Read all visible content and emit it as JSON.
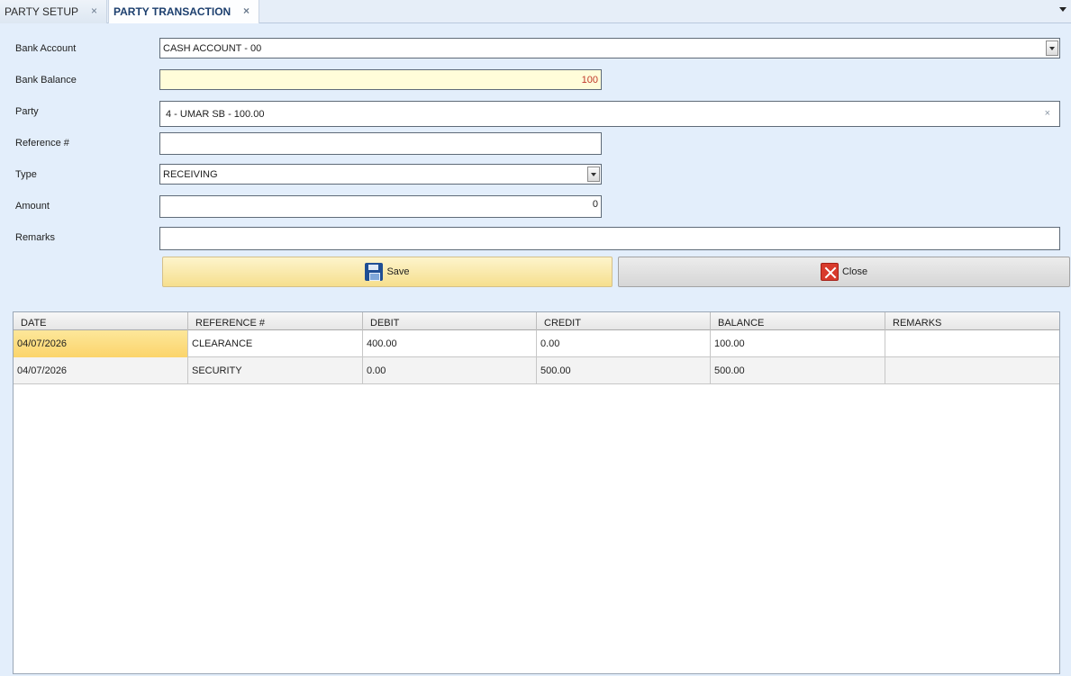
{
  "tabs": [
    {
      "label": "PARTY SETUP",
      "close": "×"
    },
    {
      "label": "PARTY TRANSACTION",
      "close": "×"
    }
  ],
  "form": {
    "bank_account": {
      "label": "Bank Account",
      "value": "CASH ACCOUNT - 00"
    },
    "bank_balance": {
      "label": "Bank Balance",
      "value": "100"
    },
    "party": {
      "label": "Party",
      "value": "4 - UMAR SB - 100.00",
      "clear": "×"
    },
    "reference": {
      "label": "Reference #",
      "value": ""
    },
    "type": {
      "label": "Type",
      "value": "RECEIVING"
    },
    "amount": {
      "label": "Amount",
      "value": "0"
    },
    "remarks": {
      "label": "Remarks",
      "value": ""
    }
  },
  "buttons": {
    "save": "Save",
    "close": "Close"
  },
  "grid": {
    "columns": [
      "DATE",
      "REFERENCE #",
      "DEBIT",
      "CREDIT",
      "BALANCE",
      "REMARKS"
    ],
    "rows": [
      [
        "04/07/2026",
        "CLEARANCE",
        "400.00",
        "0.00",
        "100.00",
        ""
      ],
      [
        "04/07/2026",
        "SECURITY",
        "0.00",
        "500.00",
        "500.00",
        ""
      ]
    ]
  },
  "colors": {
    "balance_text": "#c0392b",
    "accent": "#1c3f6e"
  }
}
